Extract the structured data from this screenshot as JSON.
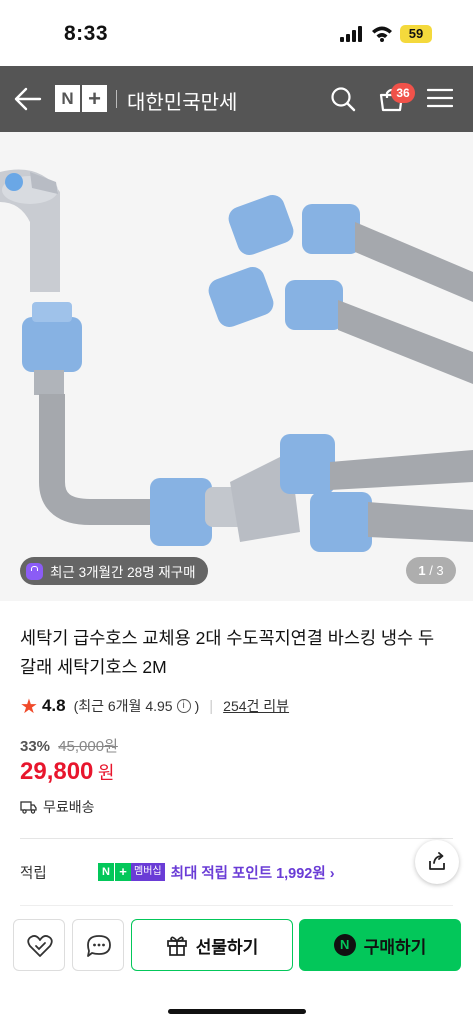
{
  "status_bar": {
    "time": "8:33",
    "battery": "59"
  },
  "header": {
    "logo_n": "N",
    "logo_plus": "+",
    "store_name": "대한민국만세",
    "cart_count": "36"
  },
  "hero": {
    "repurchase_badge": "최근 3개월간 28명 재구매",
    "pager_current": "1",
    "pager_total": "/ 3"
  },
  "product": {
    "title": "세탁기 급수호스 교체용 2대 수도꼭지연결 바스킹 냉수 두갈래 세탁기호스 2M",
    "rating": "4.8",
    "recent_rating_prefix": "(최근 6개월 4.95",
    "recent_rating_suffix": ")",
    "reviews": "254건 리뷰",
    "discount_pct": "33%",
    "original_price": "45,000원",
    "price": "29,800",
    "price_unit": "원",
    "shipping": "무료배송"
  },
  "points": {
    "label": "적립",
    "badge_n": "N",
    "badge_plus": "+",
    "badge_member": "멤버십",
    "text": "최대 적립 포인트 1,992원 ›"
  },
  "bottom_bar": {
    "gift_label": "선물하기",
    "buy_logo": "N",
    "buy_label": "구매하기"
  },
  "colors": {
    "header_bg": "#555555",
    "price_red": "#e8162d",
    "naver_green": "#03c75a",
    "membership_purple": "#6a3cd6",
    "star": "#f04a2a",
    "cart_badge": "#f0524a"
  }
}
